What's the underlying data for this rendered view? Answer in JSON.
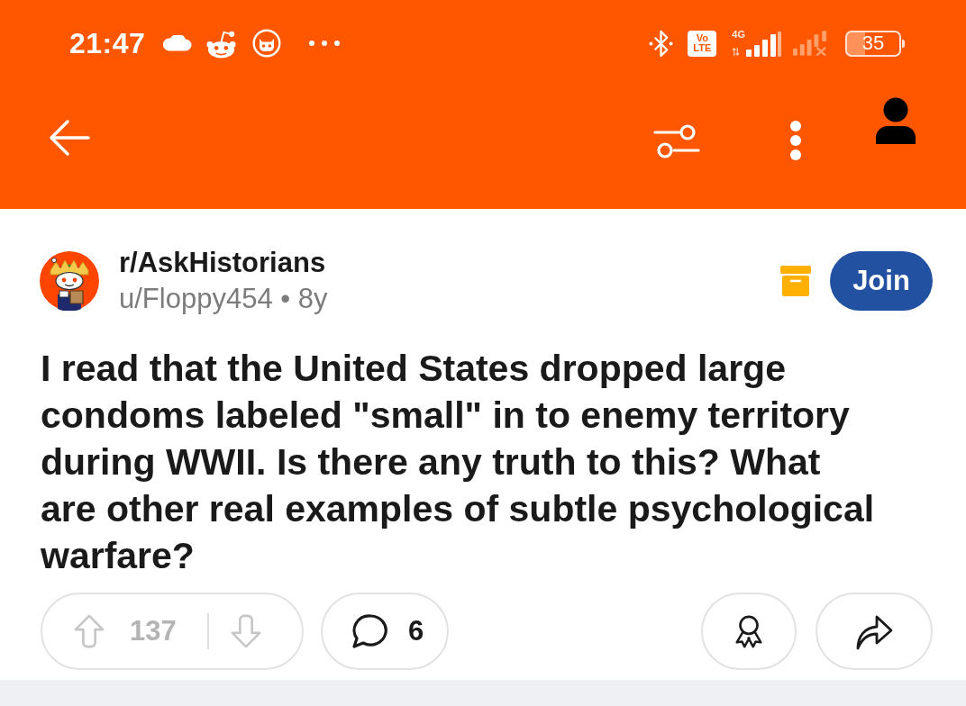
{
  "status_bar": {
    "time": "21:47",
    "volte_badge": [
      "Vo",
      "LTE"
    ],
    "network_type": "4G",
    "battery": "35"
  },
  "post": {
    "subreddit": "r/AskHistorians",
    "meta": "u/Floppy454 • 8y",
    "archived": true,
    "join_label": "Join",
    "title": "I read that the United States dropped large condoms labeled \"small\" in to enemy territory during WWII. Is there any truth to this? What are other real examples of subtle psychological warfare?"
  },
  "actions": {
    "votes": {
      "score": "137",
      "disabled": true
    },
    "comments": "6"
  }
}
